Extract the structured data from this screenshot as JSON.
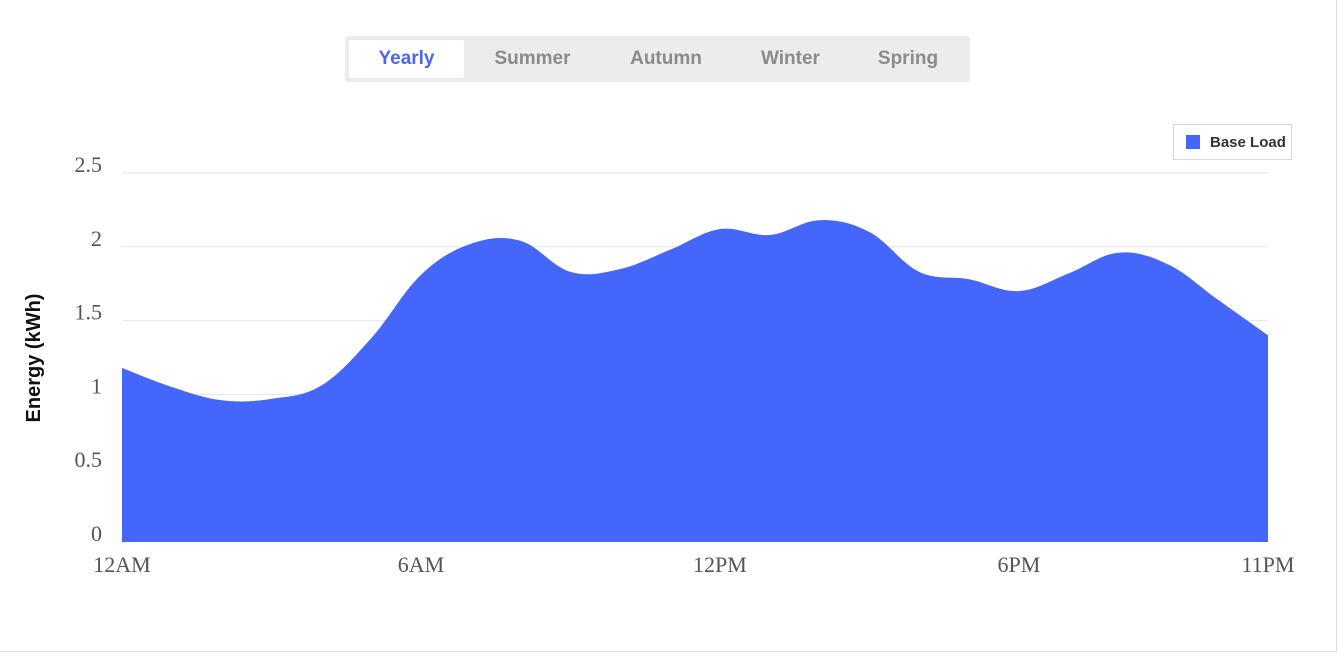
{
  "tabs": [
    {
      "label": "Yearly",
      "active": true
    },
    {
      "label": "Summer",
      "active": false
    },
    {
      "label": "Autumn",
      "active": false
    },
    {
      "label": "Winter",
      "active": false
    },
    {
      "label": "Spring",
      "active": false
    }
  ],
  "chart_data": {
    "type": "area",
    "ylabel": "Energy (kWh)",
    "ylim": [
      0,
      2.5
    ],
    "yticks": [
      "0",
      "0.5",
      "1",
      "1.5",
      "2",
      "2.5"
    ],
    "xticks": [
      {
        "hour": 0,
        "label": "12AM"
      },
      {
        "hour": 6,
        "label": "6AM"
      },
      {
        "hour": 12,
        "label": "12PM"
      },
      {
        "hour": 18,
        "label": "6PM"
      },
      {
        "hour": 23,
        "label": "11PM"
      }
    ],
    "legend_position": "top-right",
    "grid": true,
    "series": [
      {
        "name": "Base Load",
        "color": "#4466fb",
        "x": [
          0,
          1,
          2,
          3,
          4,
          5,
          6,
          7,
          8,
          9,
          10,
          11,
          12,
          13,
          14,
          15,
          16,
          17,
          18,
          19,
          20,
          21,
          22,
          23
        ],
        "values": [
          1.18,
          1.05,
          0.96,
          0.97,
          1.06,
          1.38,
          1.81,
          2.02,
          2.04,
          1.83,
          1.85,
          1.98,
          2.12,
          2.08,
          2.18,
          2.1,
          1.83,
          1.78,
          1.7,
          1.82,
          1.96,
          1.88,
          1.64,
          1.4
        ]
      }
    ]
  }
}
